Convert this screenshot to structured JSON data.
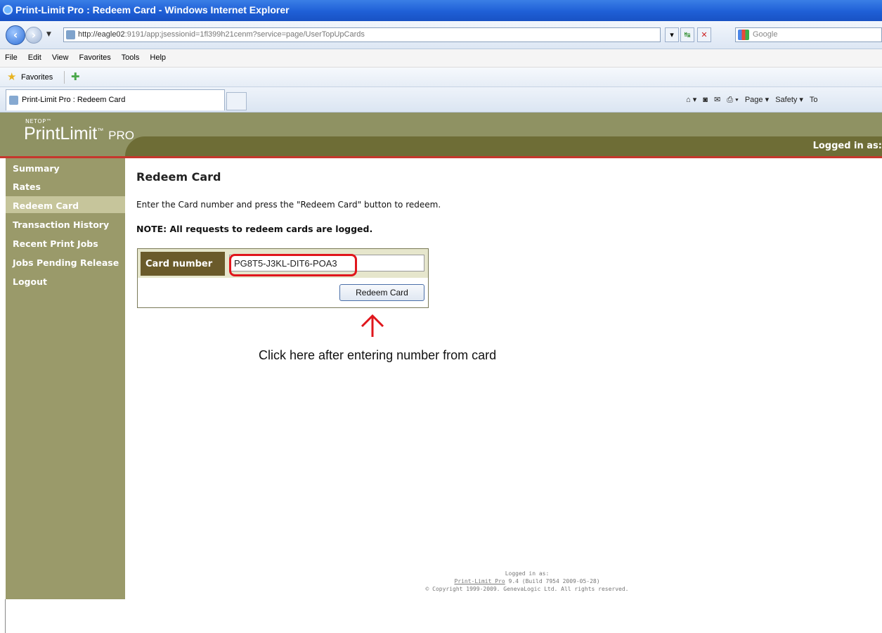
{
  "window": {
    "title": "Print-Limit Pro : Redeem Card - Windows Internet Explorer"
  },
  "browser": {
    "url_host": "http://eagle02",
    "url_rest": ":9191/app;jsessionid=1fl399h21cenm?service=page/UserTopUpCards",
    "search_engine": "Google",
    "menu": [
      "File",
      "Edit",
      "View",
      "Favorites",
      "Tools",
      "Help"
    ],
    "favorites_label": "Favorites",
    "tab_title": "Print-Limit Pro : Redeem Card",
    "commands": [
      "Page ▾",
      "Safety ▾",
      "To"
    ]
  },
  "app": {
    "logo_top": "NETOP™",
    "logo_name": "PrintLimit",
    "logo_suffix": "PRO",
    "logged_in_label": "Logged in as:",
    "brand_colors": {
      "banner": "#8f9263",
      "band": "#6e6d36",
      "accent_line": "#c6372d",
      "sidebar": "#9a9a6a"
    }
  },
  "sidebar": {
    "items": [
      {
        "label": "Summary"
      },
      {
        "label": "Rates"
      },
      {
        "label": "Redeem Card"
      },
      {
        "label": "Transaction History"
      },
      {
        "label": "Recent Print Jobs"
      },
      {
        "label": "Jobs Pending Release"
      },
      {
        "label": "Logout"
      }
    ],
    "active_label": "Redeem Card"
  },
  "main": {
    "title": "Redeem Card",
    "intro": "Enter the Card number and press the \"Redeem Card\" button to redeem.",
    "note": "NOTE: All requests to redeem cards are logged.",
    "form": {
      "card_label": "Card number",
      "card_value": "PG8T5-J3KL-DIT6-POA3",
      "submit_label": "Redeem Card"
    },
    "annotation": "Click here after entering number from card"
  },
  "footer": {
    "logged_in": "Logged in as:",
    "product_link": "Print-Limit Pro",
    "version": "9.4 (Build 7954 2009-05-28)",
    "copyright": "© Copyright 1999-2009. GenevaLogic Ltd. All rights reserved."
  }
}
